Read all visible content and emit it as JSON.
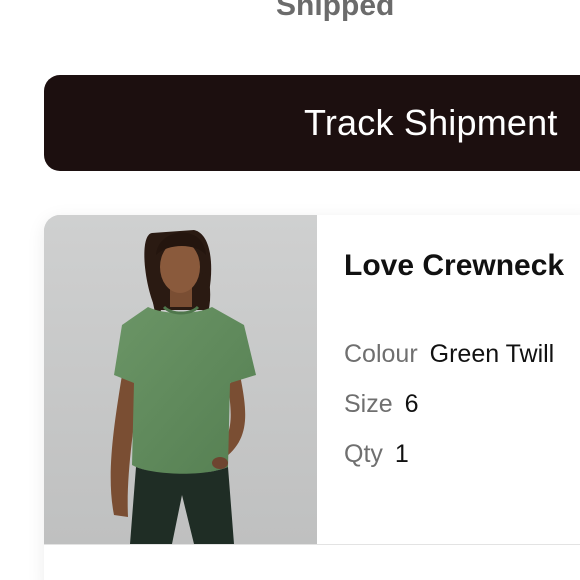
{
  "order": {
    "status": "Shipped"
  },
  "actions": {
    "track_label": "Track Shipment"
  },
  "product": {
    "name": "Love Crewneck",
    "image_alt": "Woman wearing green t-shirt",
    "attributes": [
      {
        "label": "Colour",
        "value": "Green Twill"
      },
      {
        "label": "Size",
        "value": "6"
      },
      {
        "label": "Qty",
        "value": "1"
      }
    ]
  },
  "colors": {
    "button_bg": "#1c0f0f",
    "shirt": "#5f8a5b",
    "pants": "#1f2d25",
    "photo_bg": "#c9caca"
  }
}
